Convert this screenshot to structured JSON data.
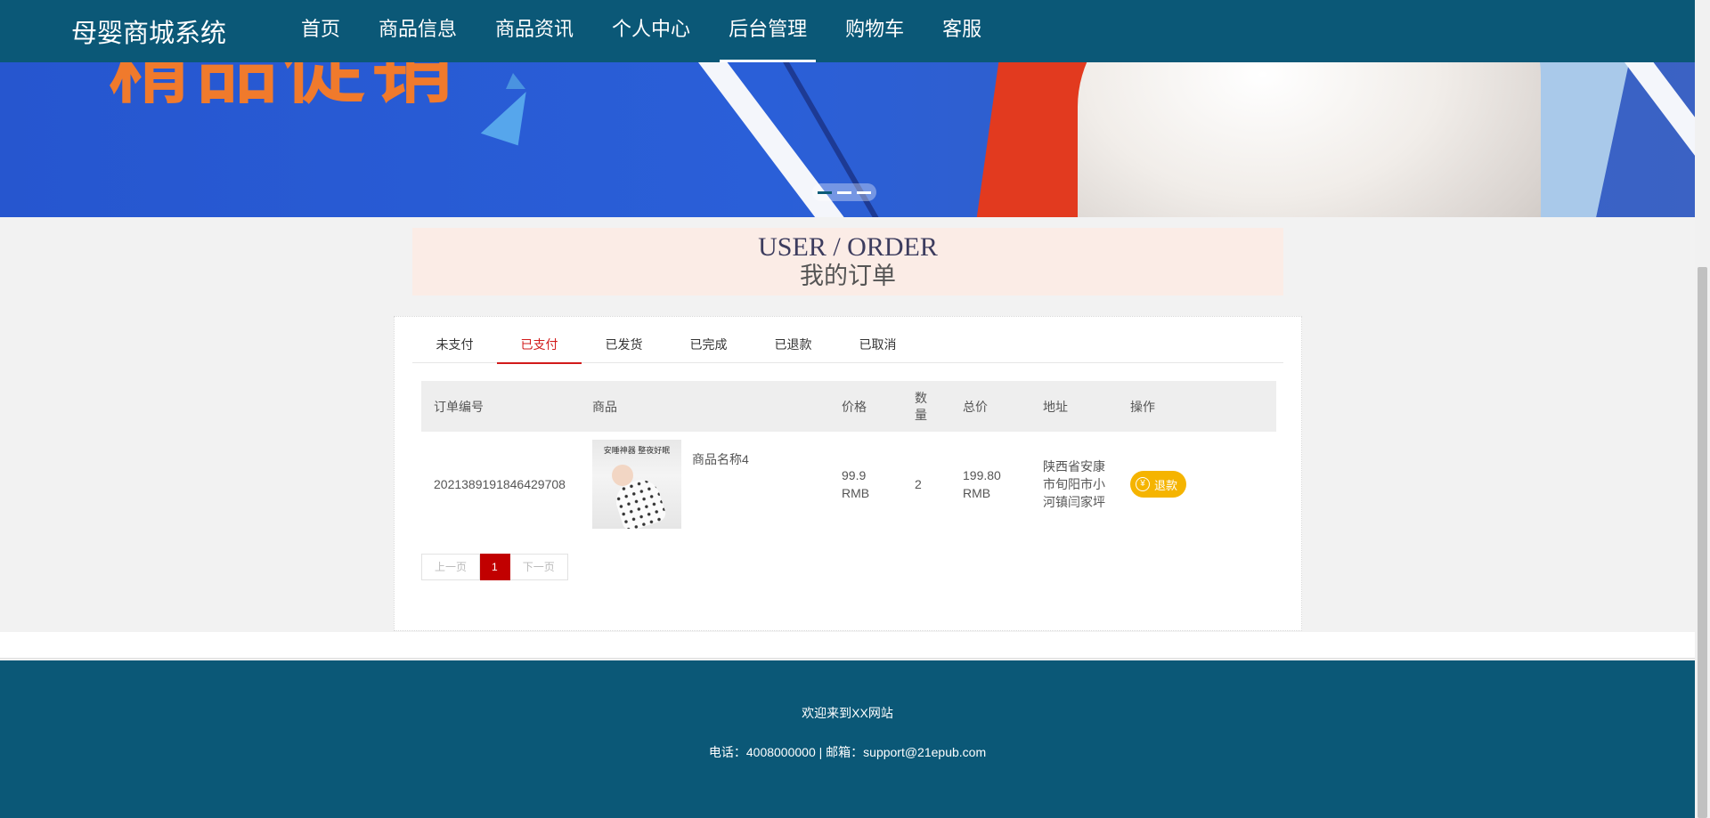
{
  "header": {
    "brand": "母婴商城系统",
    "nav": [
      {
        "label": "首页",
        "active": false
      },
      {
        "label": "商品信息",
        "active": false
      },
      {
        "label": "商品资讯",
        "active": false
      },
      {
        "label": "个人中心",
        "active": false
      },
      {
        "label": "后台管理",
        "active": true
      },
      {
        "label": "购物车",
        "active": false
      },
      {
        "label": "客服",
        "active": false
      }
    ]
  },
  "banner": {
    "promo_text": "精品促销",
    "slide_count": 3,
    "active_slide": 1
  },
  "title": {
    "en": "USER / ORDER",
    "cn": "我的订单"
  },
  "tabs": [
    {
      "label": "未支付",
      "active": false
    },
    {
      "label": "已支付",
      "active": true
    },
    {
      "label": "已发货",
      "active": false
    },
    {
      "label": "已完成",
      "active": false
    },
    {
      "label": "已退款",
      "active": false
    },
    {
      "label": "已取消",
      "active": false
    }
  ],
  "table": {
    "headers": {
      "order_no": "订单编号",
      "product": "商品",
      "price": "价格",
      "qty": "数量",
      "total": "总价",
      "address": "地址",
      "action": "操作"
    },
    "rows": [
      {
        "order_no": "2021389191846429708",
        "product_name": "商品名称4",
        "product_image_caption": "安睡神器 整夜好眠",
        "price": "99.9 RMB",
        "qty": "2",
        "total": "199.80 RMB",
        "address": "陕西省安康市旬阳市小河镇闫家坪",
        "action_label": "退款",
        "action_icon": "yen-icon"
      }
    ]
  },
  "pager": {
    "prev": "上一页",
    "current": "1",
    "next": "下一页"
  },
  "footer": {
    "welcome": "欢迎来到XX网站",
    "contact": "电话：4008000000 | 邮箱：support@21epub.com"
  },
  "colors": {
    "header_bg": "#0b5877",
    "accent_red": "#d21b1b",
    "refund_btn": "#f5b400",
    "title_box_bg": "#fbece6"
  }
}
